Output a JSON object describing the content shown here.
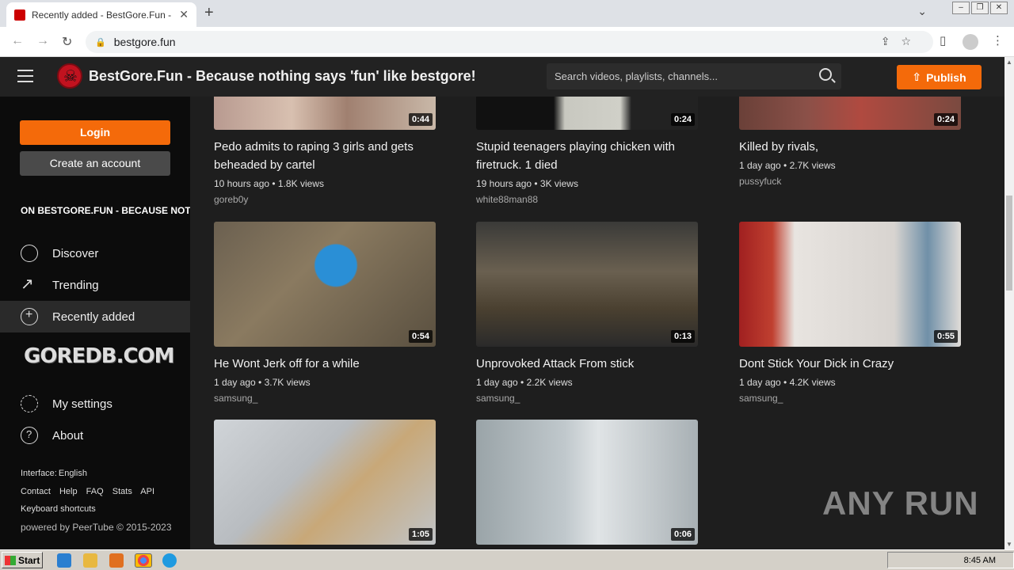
{
  "browser": {
    "tab_title": "Recently added - BestGore.Fun - Be",
    "url": "bestgore.fun"
  },
  "header": {
    "site_title": "BestGore.Fun - Because nothing says 'fun' like bestgore!",
    "search_placeholder": "Search videos, playlists, channels...",
    "publish_label": "Publish"
  },
  "sidebar": {
    "login_label": "Login",
    "create_label": "Create an account",
    "banner": "ON BESTGORE.FUN - BECAUSE NOT",
    "nav": [
      {
        "label": "Discover",
        "icon": "globe-icon"
      },
      {
        "label": "Trending",
        "icon": "trending-icon"
      },
      {
        "label": "Recently added",
        "icon": "plus-circle-icon"
      }
    ],
    "goredb": "GOREDB.COM",
    "nav2": [
      {
        "label": "My settings",
        "icon": "gear-icon"
      },
      {
        "label": "About",
        "icon": "help-icon"
      }
    ],
    "interface_label": "Interface:",
    "interface_value": "English",
    "links": [
      "Contact",
      "Help",
      "FAQ",
      "Stats",
      "API"
    ],
    "shortcuts": "Keyboard shortcuts",
    "powered": "powered by PeerTube © 2015-2023"
  },
  "videos": [
    {
      "title": "Pedo admits to raping 3 girls and gets beheaded by cartel",
      "meta": "10 hours ago • 1.8K views",
      "account": "goreb0y",
      "duration": "0:44"
    },
    {
      "title": "Stupid teenagers playing chicken with firetruck. 1 died",
      "meta": "19 hours ago • 3K views",
      "account": "white88man88",
      "duration": "0:24"
    },
    {
      "title": "Killed by rivals,",
      "meta": "1 day ago • 2.7K views",
      "account": "pussyfuck",
      "duration": "0:24"
    },
    {
      "title": "He Wont Jerk off for a while",
      "meta": "1 day ago • 3.7K views",
      "account": "samsung_",
      "duration": "0:54"
    },
    {
      "title": "Unprovoked Attack From stick",
      "meta": "1 day ago • 2.2K views",
      "account": "samsung_",
      "duration": "0:13"
    },
    {
      "title": "Dont Stick Your Dick in Crazy",
      "meta": "1 day ago • 4.2K views",
      "account": "samsung_",
      "duration": "0:55"
    },
    {
      "title": "",
      "meta": "",
      "account": "",
      "duration": "1:05"
    },
    {
      "title": "",
      "meta": "",
      "account": "",
      "duration": "0:06"
    }
  ],
  "watermark": "ANY RUN",
  "taskbar": {
    "start": "Start",
    "time": "8:45 AM"
  }
}
